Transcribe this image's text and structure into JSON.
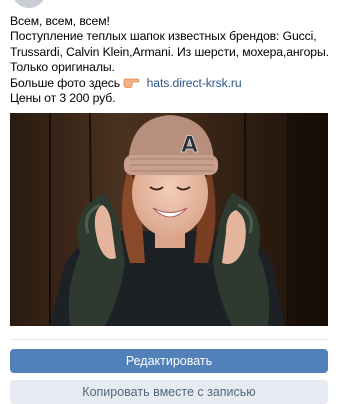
{
  "post": {
    "lines": [
      "Всем, всем, всем!",
      "Поступление теплых шапок известных брендов: Gucci,",
      "Trussardi, Calvin Klein,Armani. Из шерсти, мохера,ангоры.",
      "Только оригиналы."
    ],
    "more_photos_label": "Больше фото здесь",
    "link_text": "hats.direct-krsk.ru",
    "price": "Цены от 3 200 руб."
  },
  "photo": {
    "hat_letter": "A"
  },
  "icons": {
    "pointing_hand": "pointing-right-hand-emoji"
  },
  "buttons": {
    "edit_label": "Редактировать",
    "copy_label": "Копировать вместе с записью"
  },
  "colors": {
    "primary_button": "#5181b8",
    "secondary_button": "#e5ebf1",
    "link": "#2a5885"
  }
}
